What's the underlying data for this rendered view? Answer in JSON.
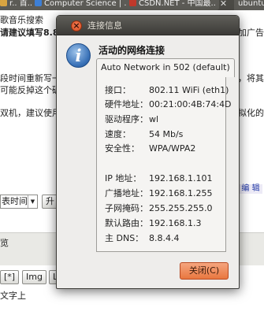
{
  "browser": {
    "tabs": [
      {
        "label": "r.. 首..",
        "color": "#d9a441"
      },
      {
        "label": "Computer Science | ...",
        "color": "#3d7fd6"
      },
      {
        "label": "CSDN.NET - 中国最..",
        "color": "#c0392b"
      }
    ],
    "right_tab": "ubuntu论"
  },
  "page": {
    "line1": "歌音乐搜索",
    "line2": "请建议填写8.8.4.",
    "line2_right": "添加广告",
    "line3": "段时间重新写一个",
    "line3_right": "时，将其",
    "line4": "可能反掉这个破解",
    "line5": "双机，建议使用服",
    "line5_right": "虚拟化的",
    "edit_label": "编 辑",
    "select_value": "表时间",
    "btn_sheng": "升",
    "lower_label": "览",
    "btn_star": "[*]",
    "btn_img": "Img",
    "btn_right": "L",
    "bottom_text": "文字上"
  },
  "dialog": {
    "title": "连接信息",
    "heading": "活动的网络连接",
    "connection_tab": "Auto Network in 502 (default)",
    "rows": [
      {
        "label": "接口：",
        "value": "802.11 WiFi (eth1)"
      },
      {
        "label": "硬件地址：",
        "value": "00:21:00:4B:74:4D"
      },
      {
        "label": "驱动程序：",
        "value": "wl"
      },
      {
        "label": "速度：",
        "value": "54 Mb/s"
      },
      {
        "label": "安全性：",
        "value": "WPA/WPA2"
      },
      {
        "label": "IP 地址：",
        "value": "192.168.1.101"
      },
      {
        "label": "广播地址：",
        "value": "192.168.1.255"
      },
      {
        "label": "子网掩码：",
        "value": "255.255.255.0"
      },
      {
        "label": "默认路由：",
        "value": "192.168.1.3"
      },
      {
        "label": "主 DNS：",
        "value": "8.8.4.4"
      }
    ],
    "close_label": "关闭(C)"
  },
  "colors": {
    "titlebar": "#3c3b37",
    "close_button": "#e9773f",
    "info_icon": "#3a72b8"
  }
}
